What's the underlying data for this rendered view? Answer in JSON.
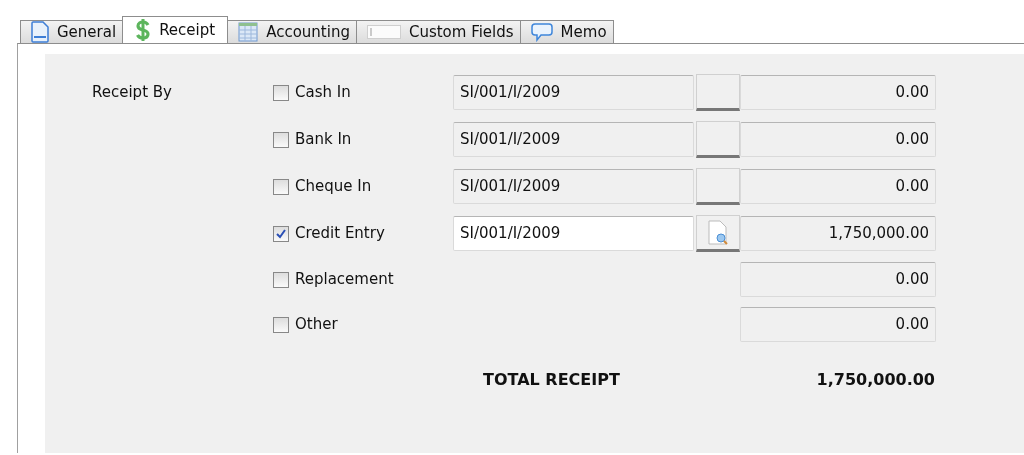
{
  "tabs": [
    {
      "label": "General",
      "selected": false
    },
    {
      "label": "Receipt",
      "selected": true
    },
    {
      "label": "Accounting",
      "selected": false
    },
    {
      "label": "Custom Fields",
      "selected": false
    },
    {
      "label": "Memo",
      "selected": false
    }
  ],
  "receipt_by_label": "Receipt By",
  "methods": [
    {
      "label": "Cash In",
      "checked": false,
      "reference": "SI/001/I/2009",
      "amount": "0.00"
    },
    {
      "label": "Bank In",
      "checked": false,
      "reference": "SI/001/I/2009",
      "amount": "0.00"
    },
    {
      "label": "Cheque In",
      "checked": false,
      "reference": "SI/001/I/2009",
      "amount": "0.00"
    },
    {
      "label": "Credit Entry",
      "checked": true,
      "reference": "SI/001/I/2009",
      "amount": "1,750,000.00"
    },
    {
      "label": "Replacement",
      "checked": false,
      "amount": "0.00"
    },
    {
      "label": "Other",
      "checked": false,
      "amount": "0.00"
    }
  ],
  "total": {
    "label": "TOTAL RECEIPT",
    "amount": "1,750,000.00"
  }
}
